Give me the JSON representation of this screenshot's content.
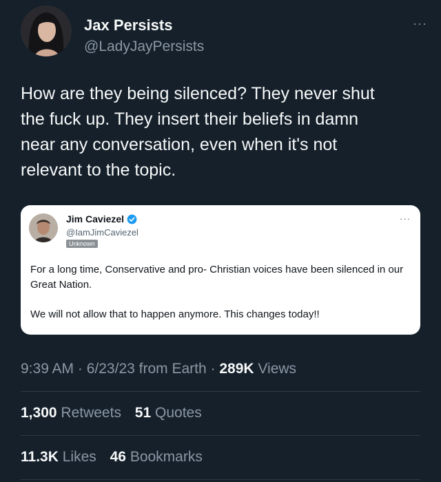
{
  "author": {
    "name": "Jax Persists",
    "handle": "@LadyJayPersists"
  },
  "more_label": "···",
  "tweet": {
    "lines": [
      "How are they being silenced? They never shut",
      "the fuck up. They insert their beliefs in damn",
      "near any conversation, even when it's not",
      "relevant to the topic."
    ]
  },
  "quoted": {
    "name": "Jim Caviezel",
    "handle": "@IamJimCaviezel",
    "badge": "Unknown",
    "more_label": "···",
    "paragraph1": "For a long time, Conservative and pro- Christian voices have been silenced in our Great Nation.",
    "paragraph2": "We will not allow that to happen anymore. This changes today!!"
  },
  "meta": {
    "time": "9:39 AM",
    "sep1": " · ",
    "date": "6/23/23",
    "source": " from Earth",
    "sep2": " · ",
    "views_count": "289K",
    "views_label": " Views"
  },
  "stats": {
    "retweets_count": "1,300",
    "retweets_label": "Retweets",
    "quotes_count": "51",
    "quotes_label": "Quotes",
    "likes_count": "11.3K",
    "likes_label": "Likes",
    "bookmarks_count": "46",
    "bookmarks_label": "Bookmarks"
  },
  "colors": {
    "background": "#15202b",
    "verified": "#1d9bf0",
    "secondary_text": "#8b98a5"
  }
}
